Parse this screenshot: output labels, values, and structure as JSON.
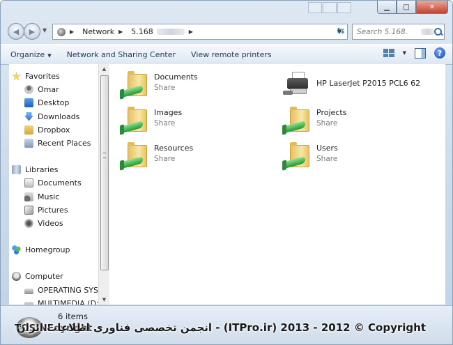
{
  "window": {
    "controls": {
      "minimize": "▁",
      "maximize": "□",
      "close": "✕"
    }
  },
  "address": {
    "crumbs": [
      "Network",
      "5.168"
    ],
    "search_placeholder": "Search 5.168."
  },
  "toolbar": {
    "organize": "Organize",
    "network_sharing": "Network and Sharing Center",
    "remote_printers": "View remote printers"
  },
  "nav": {
    "favorites": "Favorites",
    "fav_items": [
      "Omar",
      "Desktop",
      "Downloads",
      "Dropbox",
      "Recent Places"
    ],
    "libraries": "Libraries",
    "lib_items": [
      "Documents",
      "Music",
      "Pictures",
      "Videos"
    ],
    "homegroup": "Homegroup",
    "computer": "Computer",
    "drives": [
      "OPERATING SYST",
      "MULTIMEDIA (D:"
    ]
  },
  "items": [
    {
      "name": "Documents",
      "sub": "Share",
      "icon": "shared-folder-icon"
    },
    {
      "name": "HP LaserJet P2015 PCL6 62",
      "sub": "",
      "icon": "printer-icon"
    },
    {
      "name": "Images",
      "sub": "Share",
      "icon": "shared-folder-icon"
    },
    {
      "name": "Projects",
      "sub": "Share",
      "icon": "shared-folder-icon"
    },
    {
      "name": "Resources",
      "sub": "Share",
      "icon": "shared-folder-icon"
    },
    {
      "name": "Users",
      "sub": "Share",
      "icon": "shared-folder-icon"
    }
  ],
  "status": {
    "count": "6 items"
  },
  "watermark": {
    "left": "TOSINEoyright",
    "right": "انجمن تخصصی فناوری اطلاعات ایران - (ITPro.ir) 2013 - 2012 © Copyright"
  },
  "colors": {
    "accent": "#1f6bc7",
    "chrome": "#c9d9ea",
    "close": "#c7402d"
  }
}
